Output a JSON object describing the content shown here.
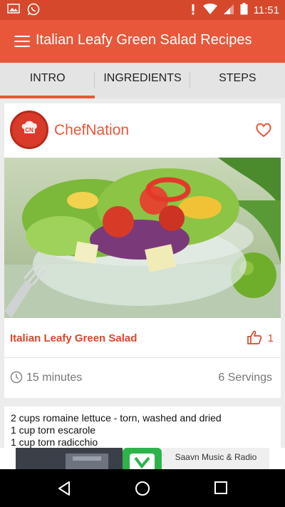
{
  "status_bar": {
    "time": "11:51",
    "icons": [
      "gallery-icon",
      "whatsapp-icon",
      "alert-icon",
      "wifi-icon",
      "signal-icon",
      "battery-icon"
    ]
  },
  "app_bar": {
    "title": "Italian Leafy Green Salad Recipes",
    "menu_icon": "hamburger-menu-icon"
  },
  "tabs": [
    {
      "label": "INTRO",
      "active": true
    },
    {
      "label": "INGREDIENTS",
      "active": false
    },
    {
      "label": "STEPS",
      "active": false
    }
  ],
  "author": {
    "name": "ChefNation",
    "avatar_icon": "chef-hat-icon",
    "favorite_icon": "heart-icon"
  },
  "recipe": {
    "name": "Italian Leafy Green Salad",
    "likes": "1",
    "like_icon": "thumbs-up-icon",
    "time": "15 minutes",
    "time_icon": "clock-icon",
    "servings": "6 Servings"
  },
  "ingredients_preview": [
    "2 cups romaine lettuce - torn, washed and dried",
    "1 cup torn escarole",
    "1 cup torn radicchio"
  ],
  "ad": {
    "text": "Saavn Music & Radio"
  },
  "colors": {
    "primary": "#e8573a",
    "primary_dark": "#d6482c",
    "tab_bg": "#e4e4e4",
    "page_bg": "#ececec"
  }
}
